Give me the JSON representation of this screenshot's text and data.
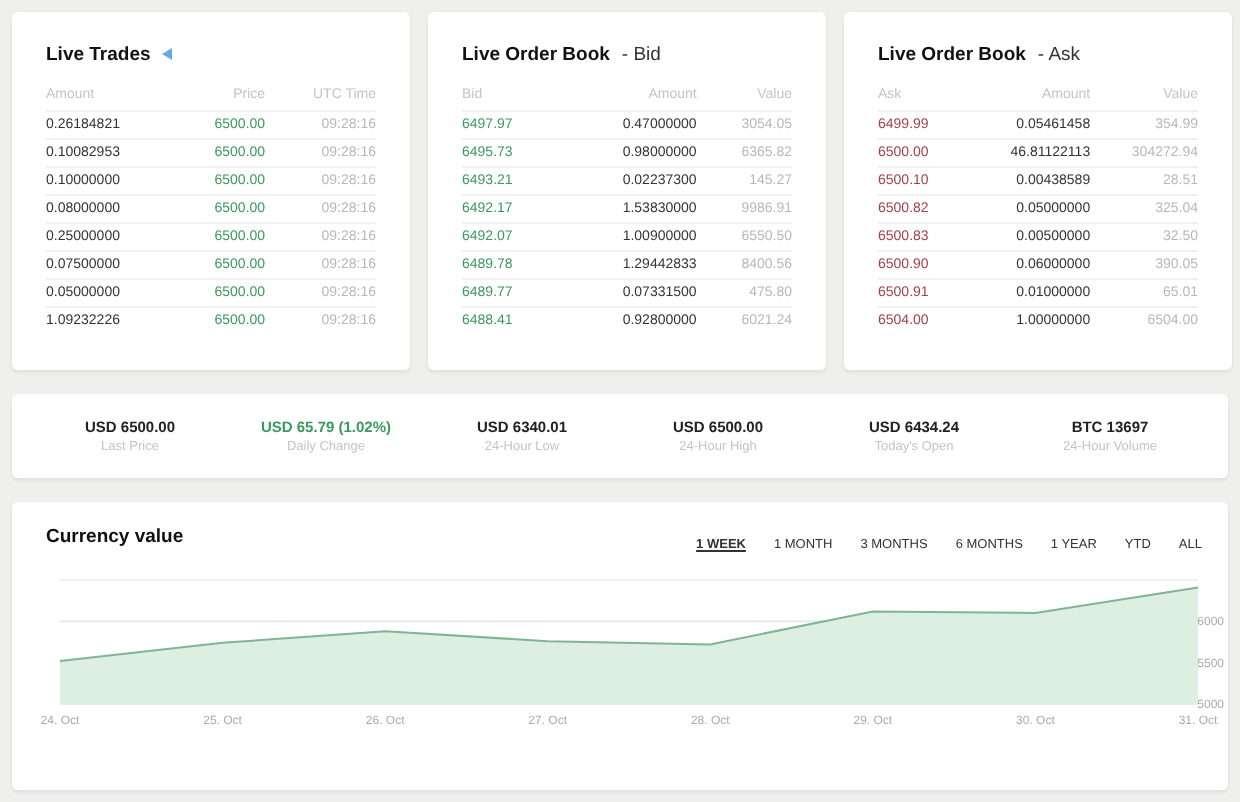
{
  "panels": [
    {
      "title": "Live Trades",
      "live_icon": true,
      "columns": [
        {
          "label": "Amount",
          "color": "#333333"
        },
        {
          "label": "Price",
          "color": "#3a9a5b"
        },
        {
          "label": "UTC Time",
          "color": "#b8b8b8"
        }
      ],
      "rows": [
        [
          "0.26184821",
          "6500.00",
          "09:28:16"
        ],
        [
          "0.10082953",
          "6500.00",
          "09:28:16"
        ],
        [
          "0.10000000",
          "6500.00",
          "09:28:16"
        ],
        [
          "0.08000000",
          "6500.00",
          "09:28:16"
        ],
        [
          "0.25000000",
          "6500.00",
          "09:28:16"
        ],
        [
          "0.07500000",
          "6500.00",
          "09:28:16"
        ],
        [
          "0.05000000",
          "6500.00",
          "09:28:16"
        ],
        [
          "1.09232226",
          "6500.00",
          "09:28:16"
        ]
      ]
    },
    {
      "title": "Live Order Book",
      "suffix": "- Bid",
      "live_icon": false,
      "columns": [
        {
          "label": "Bid",
          "color": "#3a9a5b"
        },
        {
          "label": "Amount",
          "color": "#333333"
        },
        {
          "label": "Value",
          "color": "#b8b8b8"
        }
      ],
      "rows": [
        [
          "6497.97",
          "0.47000000",
          "3054.05"
        ],
        [
          "6495.73",
          "0.98000000",
          "6365.82"
        ],
        [
          "6493.21",
          "0.02237300",
          "145.27"
        ],
        [
          "6492.17",
          "1.53830000",
          "9986.91"
        ],
        [
          "6492.07",
          "1.00900000",
          "6550.50"
        ],
        [
          "6489.78",
          "1.29442833",
          "8400.56"
        ],
        [
          "6489.77",
          "0.07331500",
          "475.80"
        ],
        [
          "6488.41",
          "0.92800000",
          "6021.24"
        ]
      ]
    },
    {
      "title": "Live Order Book",
      "suffix": "- Ask",
      "live_icon": false,
      "columns": [
        {
          "label": "Ask",
          "color": "#a5404a"
        },
        {
          "label": "Amount",
          "color": "#333333"
        },
        {
          "label": "Value",
          "color": "#b8b8b8"
        }
      ],
      "rows": [
        [
          "6499.99",
          "0.05461458",
          "354.99"
        ],
        [
          "6500.00",
          "46.81122113",
          "304272.94"
        ],
        [
          "6500.10",
          "0.00438589",
          "28.51"
        ],
        [
          "6500.82",
          "0.05000000",
          "325.04"
        ],
        [
          "6500.83",
          "0.00500000",
          "32.50"
        ],
        [
          "6500.90",
          "0.06000000",
          "390.05"
        ],
        [
          "6500.91",
          "0.01000000",
          "65.01"
        ],
        [
          "6504.00",
          "1.00000000",
          "6504.00"
        ]
      ]
    }
  ],
  "stats": [
    {
      "value": "USD 6500.00",
      "label": "Last Price",
      "color": "#222222"
    },
    {
      "value": "USD 65.79 (1.02%)",
      "label": "Daily Change",
      "color": "#3a9a5b"
    },
    {
      "value": "USD 6340.01",
      "label": "24-Hour Low",
      "color": "#222222"
    },
    {
      "value": "USD 6500.00",
      "label": "24-Hour High",
      "color": "#222222"
    },
    {
      "value": "USD 6434.24",
      "label": "Today's Open",
      "color": "#222222"
    },
    {
      "value": "BTC 13697",
      "label": "24-Hour Volume",
      "color": "#222222"
    }
  ],
  "currency_chart": {
    "title": "Currency value",
    "ranges": [
      {
        "label": "1 WEEK",
        "selected": true
      },
      {
        "label": "1 MONTH",
        "selected": false
      },
      {
        "label": "3 MONTHS",
        "selected": false
      },
      {
        "label": "6 MONTHS",
        "selected": false
      },
      {
        "label": "1 YEAR",
        "selected": false
      },
      {
        "label": "YTD",
        "selected": false
      },
      {
        "label": "ALL",
        "selected": false
      }
    ],
    "chart_data": {
      "type": "area",
      "categories": [
        "24. Oct",
        "25. Oct",
        "26. Oct",
        "27. Oct",
        "28. Oct",
        "29. Oct",
        "30. Oct",
        "31. Oct"
      ],
      "values": [
        5520,
        5740,
        5880,
        5760,
        5720,
        6120,
        6100,
        6410
      ],
      "ylim": [
        5000,
        6500
      ],
      "yticks": [
        5000,
        5500,
        6000
      ]
    }
  }
}
